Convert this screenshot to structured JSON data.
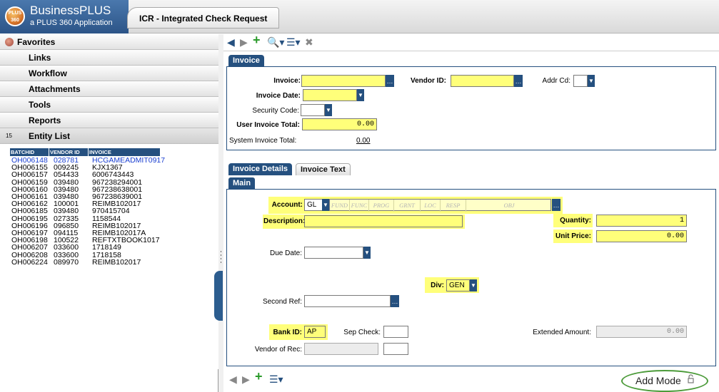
{
  "app": {
    "brand_name": "BusinessPLUS",
    "brand_sub": "a PLUS 360 Application",
    "logo_text": "PLUS 360",
    "window_title": "ICR - Integrated Check Request"
  },
  "sidebar": {
    "items": [
      {
        "label": "Favorites"
      },
      {
        "label": "Links"
      },
      {
        "label": "Workflow"
      },
      {
        "label": "Attachments"
      },
      {
        "label": "Tools"
      },
      {
        "label": "Reports"
      },
      {
        "label": "Entity List"
      }
    ],
    "entity_count": "15",
    "entity_columns": [
      "BATCHID",
      "VENDOR ID",
      "INVOICE"
    ],
    "entity_rows": [
      [
        "OH006148",
        "028781",
        "HCGAMEADMIT0917"
      ],
      [
        "OH006155",
        "009245",
        "KJX1367"
      ],
      [
        "OH006157",
        "054433",
        "6006743443"
      ],
      [
        "OH006159",
        "039480",
        "967238294001"
      ],
      [
        "OH006160",
        "039480",
        "967238638001"
      ],
      [
        "OH006161",
        "039480",
        "967238639001"
      ],
      [
        "OH006162",
        "100001",
        "REIMB102017"
      ],
      [
        "OH006185",
        "039480",
        "970415704"
      ],
      [
        "OH006195",
        "027335",
        "1158544"
      ],
      [
        "OH006196",
        "096850",
        "REIMB102017"
      ],
      [
        "OH006197",
        "094115",
        "REIMB102017A"
      ],
      [
        "OH006198",
        "100522",
        "REFTXTBOOK1017"
      ],
      [
        "OH006207",
        "033600",
        "1718149"
      ],
      [
        "OH006208",
        "033600",
        "1718158"
      ],
      [
        "OH006224",
        "089970",
        "REIMB102017"
      ]
    ]
  },
  "invoice": {
    "tab_label": "Invoice",
    "invoice_label": "Invoice:",
    "invoice_value": "",
    "vendor_id_label": "Vendor ID:",
    "vendor_id_value": "",
    "addr_cd_label": "Addr Cd:",
    "invoice_date_label": "Invoice Date:",
    "security_code_label": "Security Code:",
    "user_total_label": "User Invoice Total:",
    "user_total_value": "0.00",
    "system_total_label": "System Invoice Total:",
    "system_total_value": "0.00"
  },
  "details": {
    "tabs": [
      "Invoice Details",
      "Invoice Text"
    ],
    "subtab": "Main",
    "account_label": "Account:",
    "account_type": "GL",
    "account_segments": [
      "FUND",
      "FUNC",
      "PROG",
      "GRNT",
      "LOC",
      "RESP",
      "OBJ"
    ],
    "description_label": "Description:",
    "quantity_label": "Quantity:",
    "quantity_value": "1",
    "unit_price_label": "Unit Price:",
    "unit_price_value": "0.00",
    "due_date_label": "Due Date:",
    "div_label": "Div:",
    "div_value": "GEN",
    "second_ref_label": "Second Ref:",
    "bank_id_label": "Bank ID:",
    "bank_id_value": "AP",
    "sep_check_label": "Sep Check:",
    "extended_amount_label": "Extended Amount:",
    "extended_amount_value": "0.00",
    "vendor_of_rec_label": "Vendor of Rec:"
  },
  "status": {
    "mode": "Add Mode"
  },
  "colors": {
    "accent": "#25507f",
    "required": "#ffff7a",
    "mode_ring": "#4c9b3a"
  }
}
